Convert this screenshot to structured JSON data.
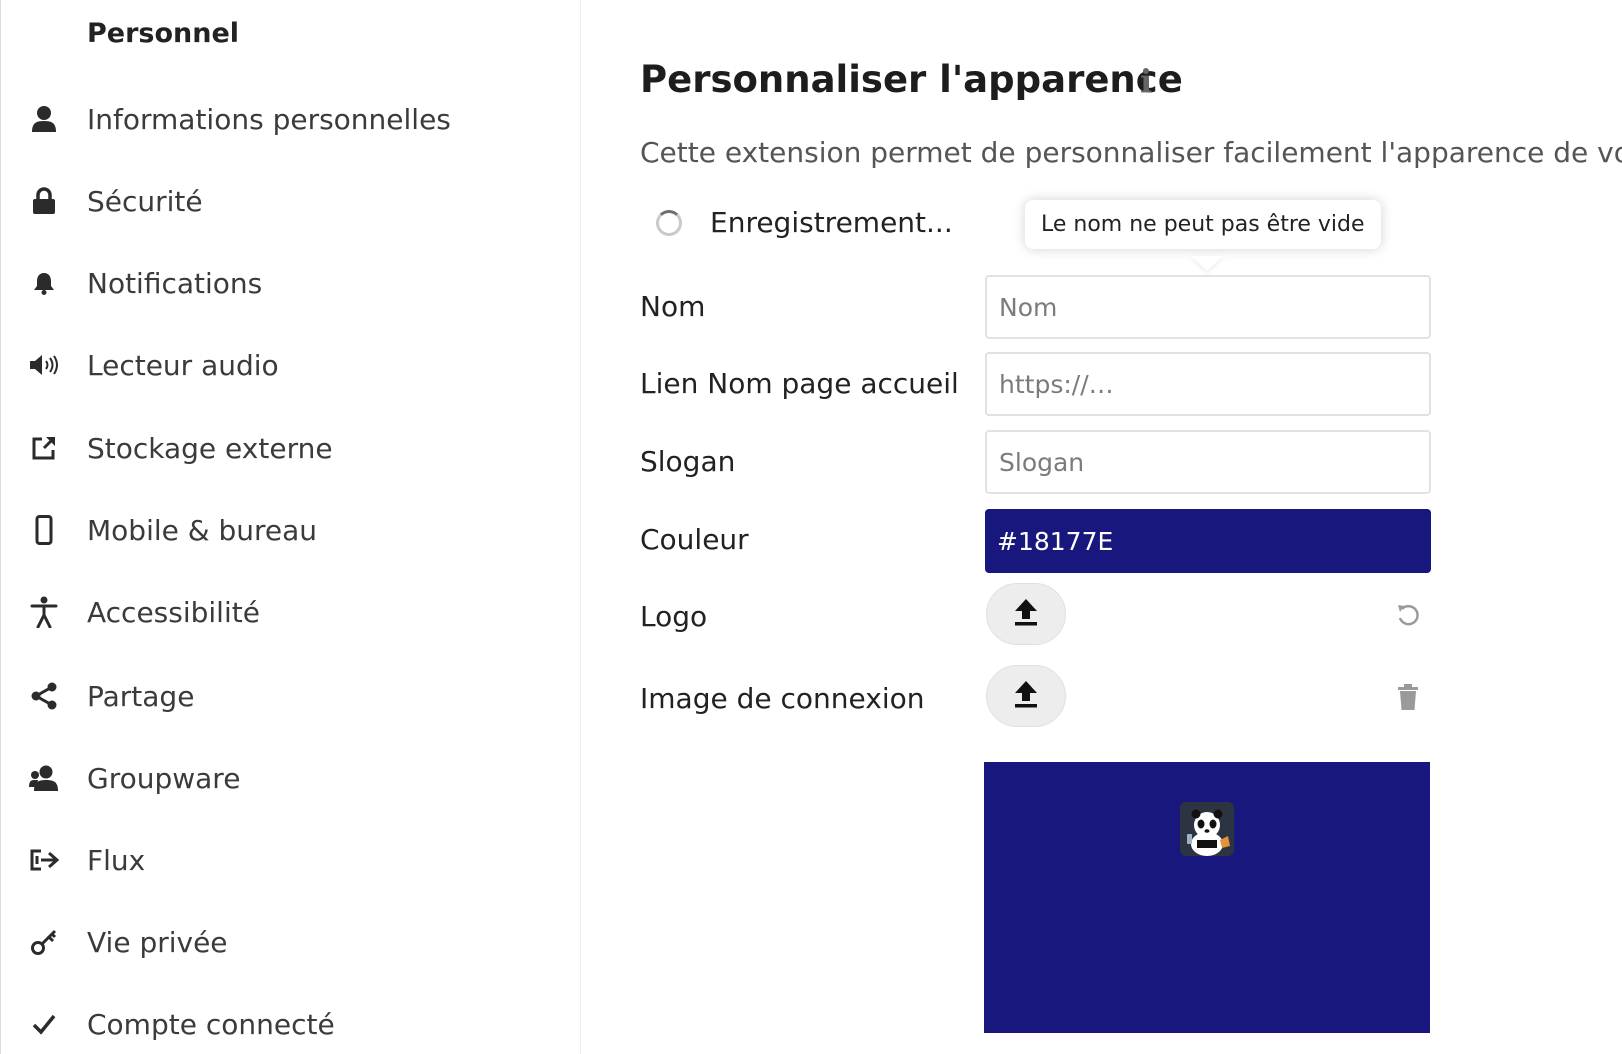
{
  "sidebar": {
    "heading": "Personnel",
    "items": [
      {
        "label": "Informations personnelles",
        "icon": "user-icon"
      },
      {
        "label": "Sécurité",
        "icon": "lock-icon"
      },
      {
        "label": "Notifications",
        "icon": "bell-icon"
      },
      {
        "label": "Lecteur audio",
        "icon": "speaker-icon"
      },
      {
        "label": "Stockage externe",
        "icon": "external-link-icon"
      },
      {
        "label": "Mobile & bureau",
        "icon": "phone-icon"
      },
      {
        "label": "Accessibilité",
        "icon": "accessibility-icon"
      },
      {
        "label": "Partage",
        "icon": "share-icon"
      },
      {
        "label": "Groupware",
        "icon": "contacts-icon"
      },
      {
        "label": "Flux",
        "icon": "activity-icon"
      },
      {
        "label": "Vie privée",
        "icon": "key-icon"
      },
      {
        "label": "Compte connecté",
        "icon": "check-icon"
      }
    ]
  },
  "main": {
    "title": "Personnaliser l'apparence",
    "description": "Cette extension permet de personnaliser facilement l'apparence de votre i",
    "saving_text": "Enregistrement...",
    "tooltip": "Le nom ne peut pas être vide",
    "fields": {
      "name_label": "Nom",
      "name_placeholder": "Nom",
      "url_label": "Lien Nom page accueil",
      "url_placeholder": "https://…",
      "slogan_label": "Slogan",
      "slogan_placeholder": "Slogan",
      "color_label": "Couleur",
      "color_value": "#18177E",
      "logo_label": "Logo",
      "login_image_label": "Image de connexion"
    },
    "colors": {
      "theme": "#18177E"
    }
  }
}
